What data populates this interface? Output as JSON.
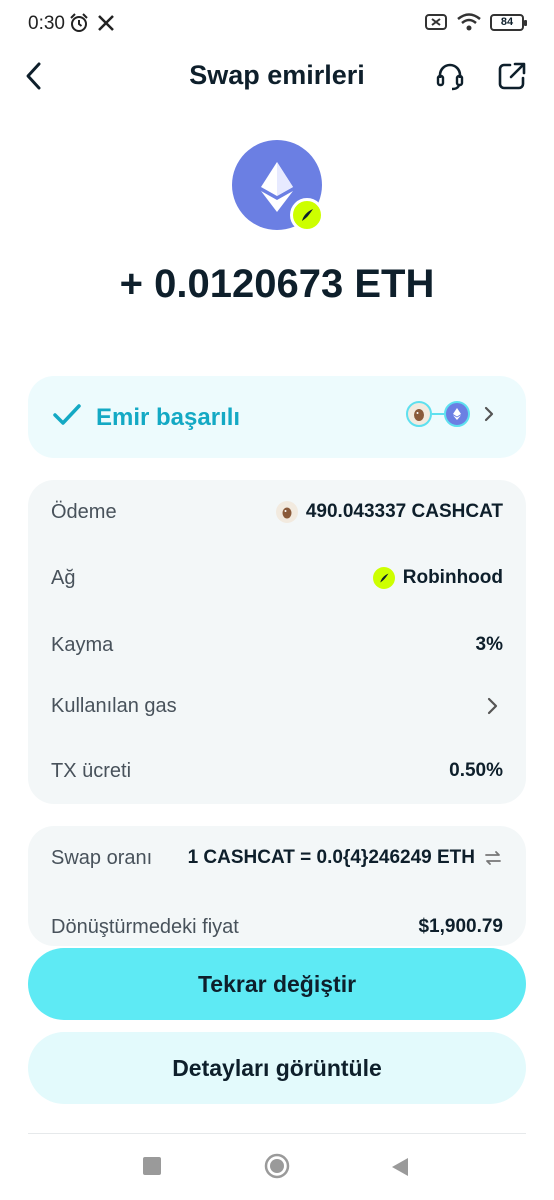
{
  "status_bar": {
    "time": "0:30",
    "battery": "84"
  },
  "header": {
    "title": "Swap emirleri"
  },
  "token": {
    "amount": "+ 0.0120673 ETH"
  },
  "order_status": {
    "text": "Emir başarılı"
  },
  "details": {
    "rows": [
      {
        "label": "Ödeme",
        "value": "490.043337 CASHCAT"
      },
      {
        "label": "Ağ",
        "value": "Robinhood"
      },
      {
        "label": "Kayma",
        "value": "3%"
      },
      {
        "label": "Kullanılan gas",
        "value": ""
      },
      {
        "label": "TX ücreti",
        "value": "0.50%"
      }
    ]
  },
  "rate": {
    "rows": [
      {
        "label": "Swap oranı",
        "value": "1 CASHCAT = 0.0{4}246249 ETH"
      },
      {
        "label": "Dönüştürmedeki fiyat",
        "value": "$1,900.79"
      }
    ]
  },
  "actions": {
    "swap_again": "Tekrar değiştir",
    "view_details": "Detayları görüntüle"
  },
  "colors": {
    "accent": "#5eeaf4",
    "success_text": "#14a9c4",
    "eth": "#6b7fe3",
    "robinhood": "#cdff00"
  }
}
